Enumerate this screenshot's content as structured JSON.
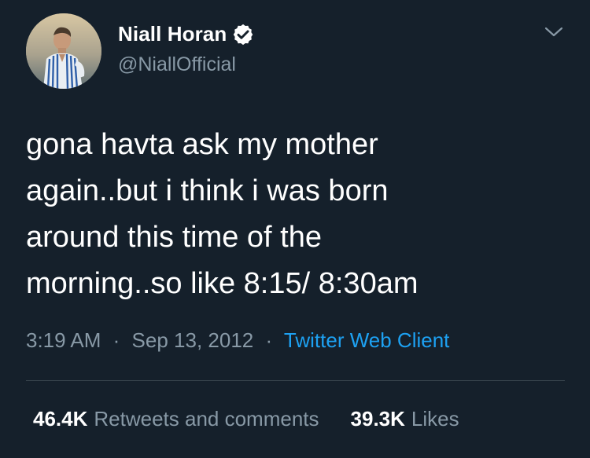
{
  "author": {
    "display_name": "Niall Horan",
    "handle": "@NiallOfficial",
    "verified": true,
    "verified_icon": "verified-badge-icon",
    "avatar_icon": "profile-photo"
  },
  "menu": {
    "icon": "chevron-down-icon"
  },
  "tweet": {
    "lines": [
      "gona havta ask my mother",
      "again..but i think i was born",
      "around this time of the",
      "morning..so like 8:15/ 8:30am"
    ]
  },
  "meta": {
    "time": "3:19 AM",
    "separator": "·",
    "date": "Sep 13, 2012",
    "client": "Twitter Web Client"
  },
  "stats": {
    "retweets_count": "46.4K",
    "retweets_label": "Retweets and comments",
    "likes_count": "39.3K",
    "likes_label": "Likes"
  },
  "colors": {
    "background": "#15202b",
    "text": "#ffffff",
    "secondary_text": "#8899a6",
    "link": "#1da1f2",
    "divider": "#38444d"
  }
}
